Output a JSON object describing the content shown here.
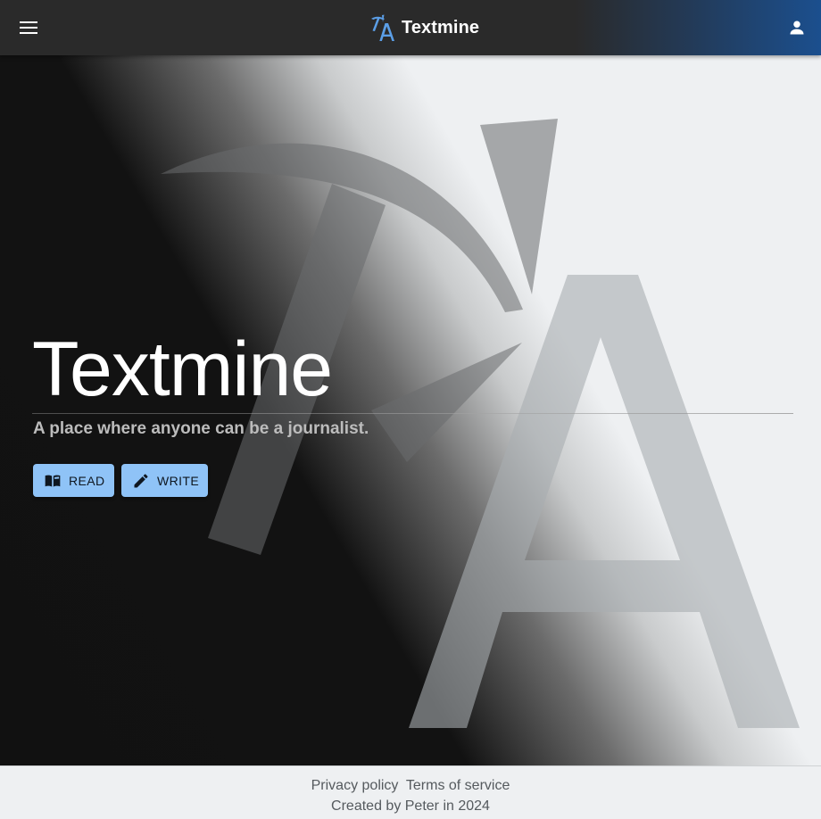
{
  "app_bar": {
    "menu_icon": "menu-icon",
    "logo_icon": "textmine-logo-icon",
    "title": "Textmine",
    "account_icon": "account-icon"
  },
  "hero": {
    "title": "Textmine",
    "tagline": "A place where anyone can be a journalist.",
    "background_logo": "pickaxe-a-logo",
    "buttons": [
      {
        "label": "READ",
        "icon": "book-open-icon"
      },
      {
        "label": "WRITE",
        "icon": "pencil-icon"
      }
    ]
  },
  "footer": {
    "links": [
      "Privacy policy",
      "Terms of service"
    ],
    "credit": "Created by Peter in 2024"
  },
  "colors": {
    "app_bar": "#2a2a2a",
    "app_bar_accent": "#1b4f8e",
    "button": "#8fc3f7",
    "logo_blue": "#5b9ee6",
    "footer_text": "#555a5e"
  }
}
